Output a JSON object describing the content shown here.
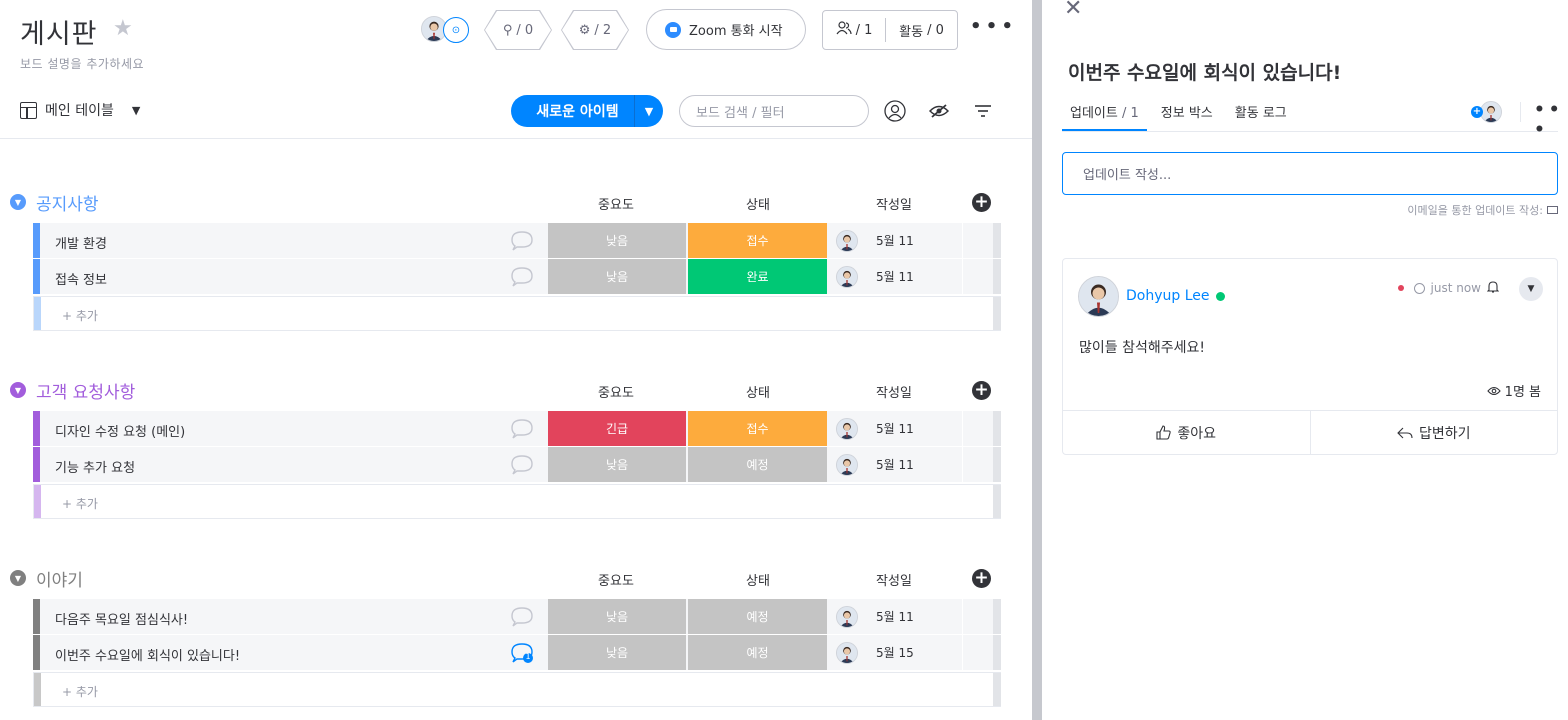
{
  "board": {
    "title": "게시판",
    "description": "보드 설명을 추가하세요",
    "automations": "/ 0",
    "integrations": "/ 2",
    "zoom_label": "Zoom 통화 시작",
    "members": "/ 1",
    "activity_label": "활동",
    "activity_count": "/ 0",
    "view_label": "메인 테이블",
    "new_item_label": "새로운 아이템",
    "search_placeholder": "보드 검색 / 필터"
  },
  "columns": {
    "priority": "중요도",
    "status": "상태",
    "created": "작성일"
  },
  "add_row_label": "+ 추가",
  "colors": {
    "accent": "#0085ff",
    "low": "#c4c4c4",
    "urgent": "#e2445c",
    "received": "#fdab3d",
    "done": "#00c875",
    "planned": "#c4c4c4",
    "group_blue": "#579bfc",
    "group_purple": "#a25ddc",
    "group_gray": "#808080"
  },
  "groups": [
    {
      "name": "공지사항",
      "color": "#579bfc",
      "light": "#b9d6fb",
      "rows": [
        {
          "name": "개발 환경",
          "priority": "낮음",
          "priority_color": "#c4c4c4",
          "status": "접수",
          "status_color": "#fdab3d",
          "date": "5월 11",
          "comments": ""
        },
        {
          "name": "접속 정보",
          "priority": "낮음",
          "priority_color": "#c4c4c4",
          "status": "완료",
          "status_color": "#00c875",
          "date": "5월 11",
          "comments": ""
        }
      ]
    },
    {
      "name": "고객 요청사항",
      "color": "#a25ddc",
      "light": "#d5b6ef",
      "rows": [
        {
          "name": "디자인 수정 요청 (메인)",
          "priority": "긴급",
          "priority_color": "#e2445c",
          "status": "접수",
          "status_color": "#fdab3d",
          "date": "5월 11",
          "comments": ""
        },
        {
          "name": "기능 추가 요청",
          "priority": "낮음",
          "priority_color": "#c4c4c4",
          "status": "예정",
          "status_color": "#c4c4c4",
          "date": "5월 11",
          "comments": ""
        }
      ]
    },
    {
      "name": "이야기",
      "color": "#808080",
      "light": "#c8c8c8",
      "rows": [
        {
          "name": "다음주 목요일 점심식사!",
          "priority": "낮음",
          "priority_color": "#c4c4c4",
          "status": "예정",
          "status_color": "#c4c4c4",
          "date": "5월 11",
          "comments": ""
        },
        {
          "name": "이번주 수요일에 회식이 있습니다!",
          "priority": "낮음",
          "priority_color": "#c4c4c4",
          "status": "예정",
          "status_color": "#c4c4c4",
          "date": "5월 15",
          "comments": "1"
        }
      ]
    }
  ],
  "panel": {
    "title": "이번주 수요일에 회식이 있습니다!",
    "tabs": [
      {
        "label": "업데이트",
        "count": "/ 1"
      },
      {
        "label": "정보 박스",
        "count": ""
      },
      {
        "label": "활동 로그",
        "count": ""
      }
    ],
    "update_placeholder": "업데이트 작성...",
    "email_note": "이메일을 통한 업데이트 작성:",
    "post": {
      "author": "Dohyup Lee",
      "time": "just now",
      "body": "많이들 참석해주세요!",
      "seen": "1명 봄",
      "like_label": "좋아요",
      "reply_label": "답변하기"
    }
  }
}
